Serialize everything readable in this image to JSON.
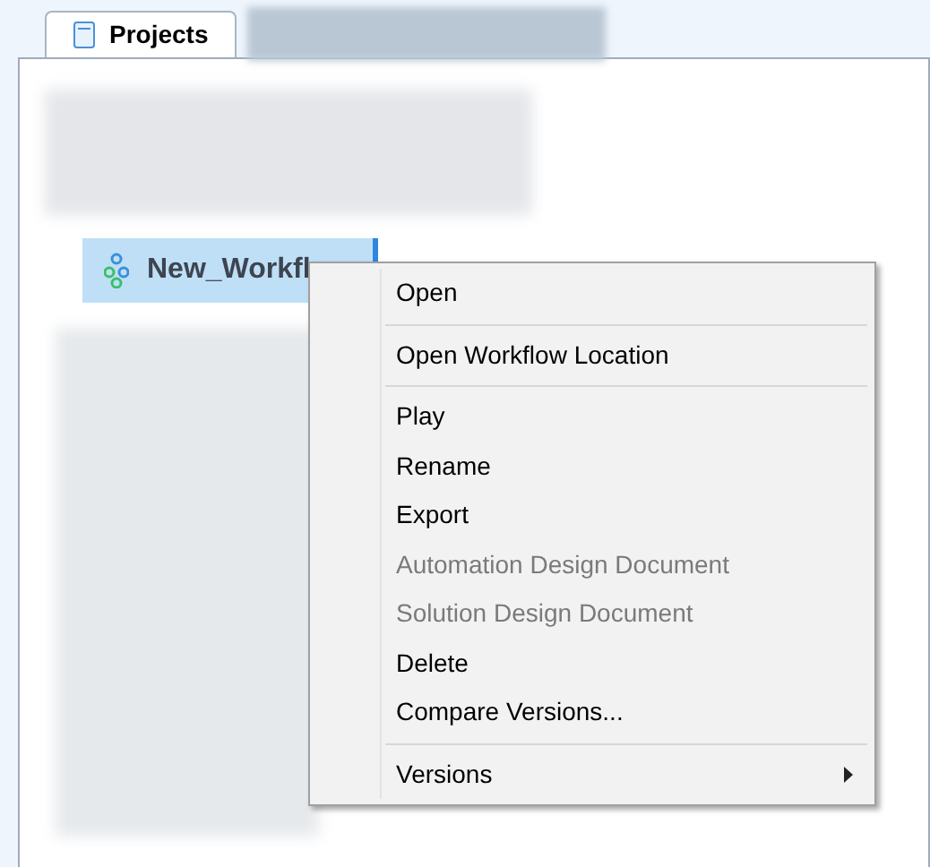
{
  "tabs": [
    {
      "label": "Projects",
      "selected": true
    }
  ],
  "tree": {
    "selected_item": {
      "label": "New_Workfl",
      "selected": true
    }
  },
  "context_menu": {
    "items": [
      {
        "kind": "item",
        "label": "Open",
        "disabled": false
      },
      {
        "kind": "separator"
      },
      {
        "kind": "item",
        "label": "Open Workflow Location",
        "disabled": false
      },
      {
        "kind": "separator"
      },
      {
        "kind": "item",
        "label": "Play",
        "disabled": false
      },
      {
        "kind": "item",
        "label": "Rename",
        "disabled": false
      },
      {
        "kind": "item",
        "label": "Export",
        "disabled": false
      },
      {
        "kind": "item",
        "label": "Automation Design Document",
        "disabled": true
      },
      {
        "kind": "item",
        "label": "Solution Design Document",
        "disabled": true
      },
      {
        "kind": "item",
        "label": "Delete",
        "disabled": false
      },
      {
        "kind": "item",
        "label": "Compare Versions...",
        "disabled": false
      },
      {
        "kind": "separator"
      },
      {
        "kind": "submenu",
        "label": "Versions",
        "disabled": false
      }
    ]
  }
}
